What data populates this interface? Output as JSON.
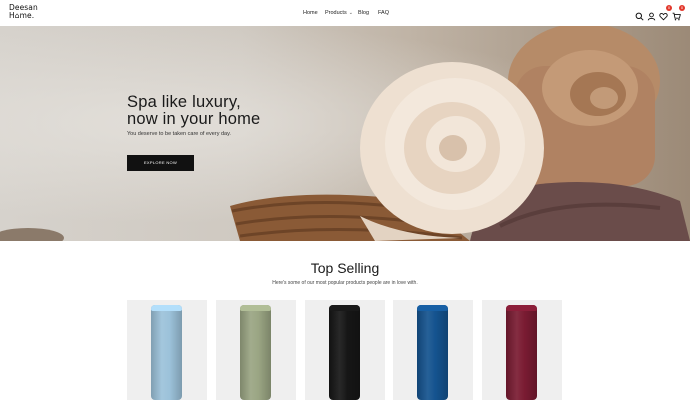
{
  "brand": {
    "line1": "Deesan",
    "line2": "H⌂me."
  },
  "nav": [
    {
      "label": "Home"
    },
    {
      "label": "Products"
    },
    {
      "label": "Blog"
    },
    {
      "label": "FAQ"
    }
  ],
  "header_icons": {
    "search": "search-icon",
    "account": "user-icon",
    "wishlist": {
      "icon": "heart-icon",
      "count": "0"
    },
    "cart": {
      "icon": "cart-icon",
      "count": "0"
    }
  },
  "hero": {
    "title_line1": "Spa like luxury,",
    "title_line2": "now in your home",
    "subtitle": "You deserve to be taken care of every day.",
    "cta": "EXPLORE NOW"
  },
  "top_selling": {
    "title": "Top Selling",
    "subtitle": "Here's some of our most popular products people are in love with.",
    "products": [
      {
        "color": "#9cc2da",
        "name": "light-blue-towel"
      },
      {
        "color": "#9aa583",
        "name": "sage-towel"
      },
      {
        "color": "#161616",
        "name": "black-towel"
      },
      {
        "color": "#14538f",
        "name": "navy-towel"
      },
      {
        "color": "#7a1b32",
        "name": "burgundy-towel"
      }
    ]
  },
  "colors": {
    "accent": "#111111",
    "badge": "#e2372b",
    "card_bg": "#efefef"
  }
}
